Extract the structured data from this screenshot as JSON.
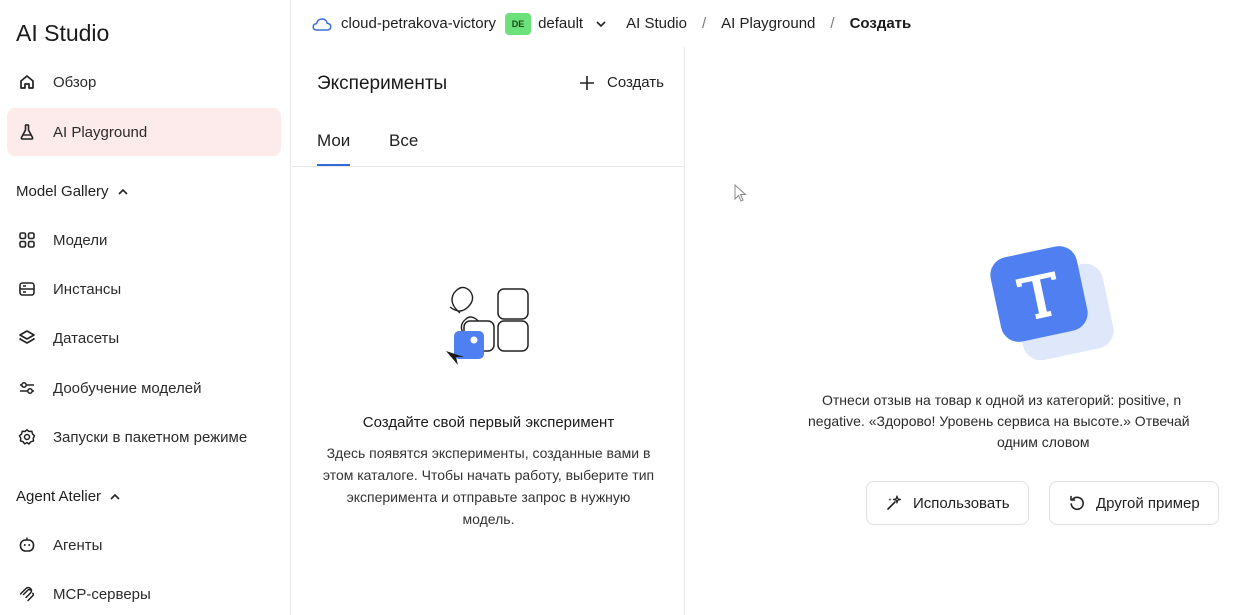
{
  "sidebar": {
    "app_title": "AI Studio",
    "items": [
      {
        "label": "Обзор",
        "icon": "home-icon"
      },
      {
        "label": "AI Playground",
        "icon": "flask-icon"
      }
    ],
    "sections": [
      {
        "title": "Model Gallery",
        "items": [
          {
            "label": "Модели",
            "icon": "grid-icon"
          },
          {
            "label": "Инстансы",
            "icon": "server-icon"
          },
          {
            "label": "Датасеты",
            "icon": "layers-icon"
          },
          {
            "label": "Дообучение моделей",
            "icon": "sliders-icon"
          },
          {
            "label": "Запуски в пакетном режиме",
            "icon": "gear-icon"
          }
        ]
      },
      {
        "title": "Agent Atelier",
        "items": [
          {
            "label": "Агенты",
            "icon": "robot-icon"
          },
          {
            "label": "MCP-серверы",
            "icon": "mcp-icon"
          }
        ]
      }
    ],
    "accent_active_bg": "#fdeaea"
  },
  "header": {
    "cloud": "cloud-petrakova-victory",
    "folder_badge": "DE",
    "folder": "default",
    "crumbs": [
      "AI Studio",
      "AI Playground",
      "Создать"
    ],
    "separator": "/"
  },
  "experiments": {
    "title": "Эксперименты",
    "create_label": "Создать",
    "tabs": [
      "Мои",
      "Все"
    ],
    "empty_title": "Создайте свой первый эксперимент",
    "empty_desc": "Здесь появятся эксперименты, созданные вами в этом каталоге. Чтобы начать работу, выберите тип эксперимента и отправьте запрос в нужную модель."
  },
  "example": {
    "line1": "Отнеси отзыв на товар к одной из категорий: positive, n",
    "line2": "negative. «Здорово! Уровень сервиса на высоте.» Отвечай",
    "line3": "одним словом",
    "use_label": "Использовать",
    "another_label": "Другой пример"
  },
  "colors": {
    "tab_underline": "#2f6bd8",
    "folder_badge": "#6ce07a",
    "icon_blue": "#4f7ff0"
  }
}
